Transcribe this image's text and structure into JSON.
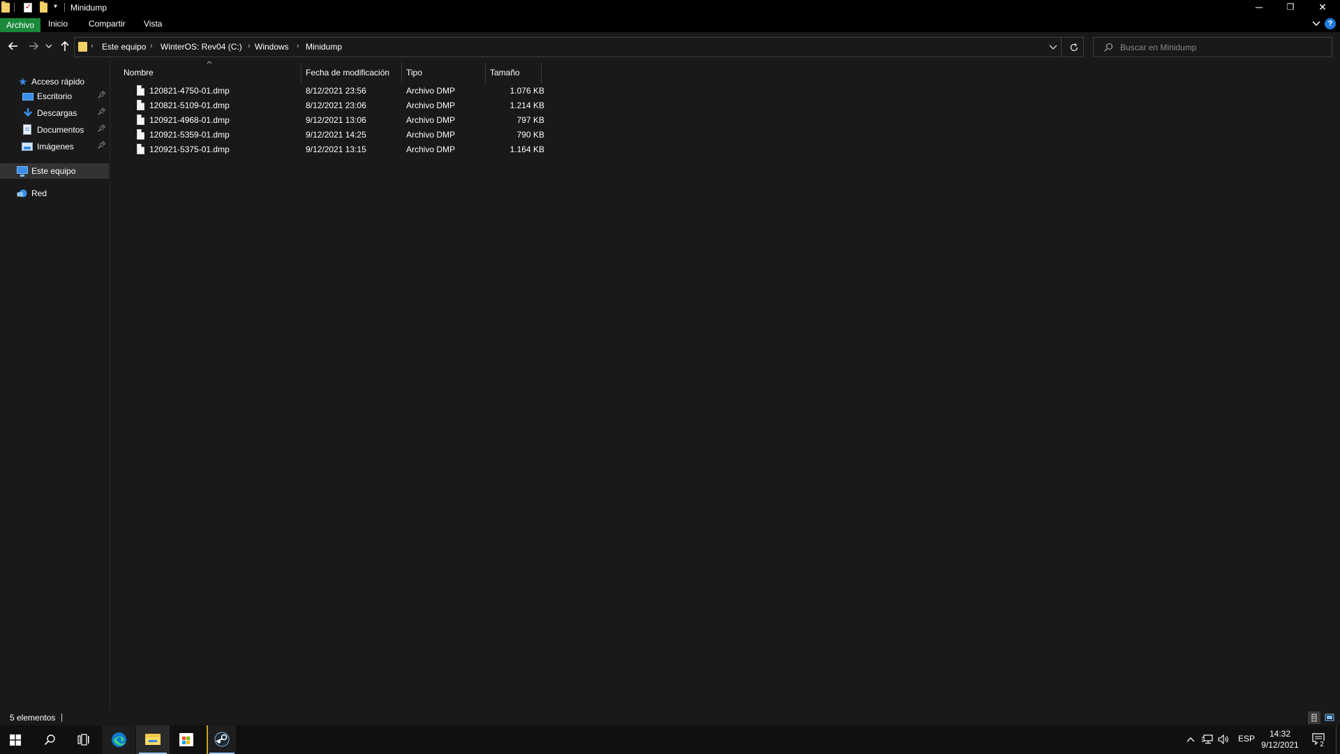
{
  "window": {
    "title": "Minidump",
    "controls": {
      "minimize": "─",
      "restore": "❐",
      "close": "✕"
    }
  },
  "ribbon": {
    "tabs": [
      "Archivo",
      "Inicio",
      "Compartir",
      "Vista"
    ],
    "expand_icon": "chevron-down",
    "help_label": "?"
  },
  "address": {
    "breadcrumbs": [
      "Este equipo",
      "WinterOS: Rev04  (C:)",
      "Windows",
      "Minidump"
    ]
  },
  "search": {
    "placeholder": "Buscar en Minidump"
  },
  "navpane": {
    "quick_access": "Acceso rápido",
    "items": [
      {
        "label": "Escritorio",
        "pinned": true,
        "icon": "desktop-icon"
      },
      {
        "label": "Descargas",
        "pinned": true,
        "icon": "downloads-icon"
      },
      {
        "label": "Documentos",
        "pinned": true,
        "icon": "documents-icon"
      },
      {
        "label": "Imágenes",
        "pinned": true,
        "icon": "pictures-icon"
      }
    ],
    "this_pc": "Este equipo",
    "network": "Red"
  },
  "columns": {
    "name": "Nombre",
    "modified": "Fecha de modificación",
    "type": "Tipo",
    "size": "Tamaño"
  },
  "files": [
    {
      "name": "120821-4750-01.dmp",
      "modified": "8/12/2021 23:56",
      "type": "Archivo DMP",
      "size": "1.076 KB"
    },
    {
      "name": "120821-5109-01.dmp",
      "modified": "8/12/2021 23:06",
      "type": "Archivo DMP",
      "size": "1.214 KB"
    },
    {
      "name": "120921-4968-01.dmp",
      "modified": "9/12/2021 13:06",
      "type": "Archivo DMP",
      "size": "797 KB"
    },
    {
      "name": "120921-5359-01.dmp",
      "modified": "9/12/2021 14:25",
      "type": "Archivo DMP",
      "size": "790 KB"
    },
    {
      "name": "120921-5375-01.dmp",
      "modified": "9/12/2021 13:15",
      "type": "Archivo DMP",
      "size": "1.164 KB"
    }
  ],
  "status": {
    "count": "5 elementos"
  },
  "taskbar": {
    "lang": "ESP",
    "time": "14:32",
    "date": "9/12/2021",
    "notifications": "2"
  },
  "colors": {
    "accent_green": "#1a8a3a",
    "folder_yellow": "#f4d068",
    "link_blue": "#3a8ee6"
  }
}
